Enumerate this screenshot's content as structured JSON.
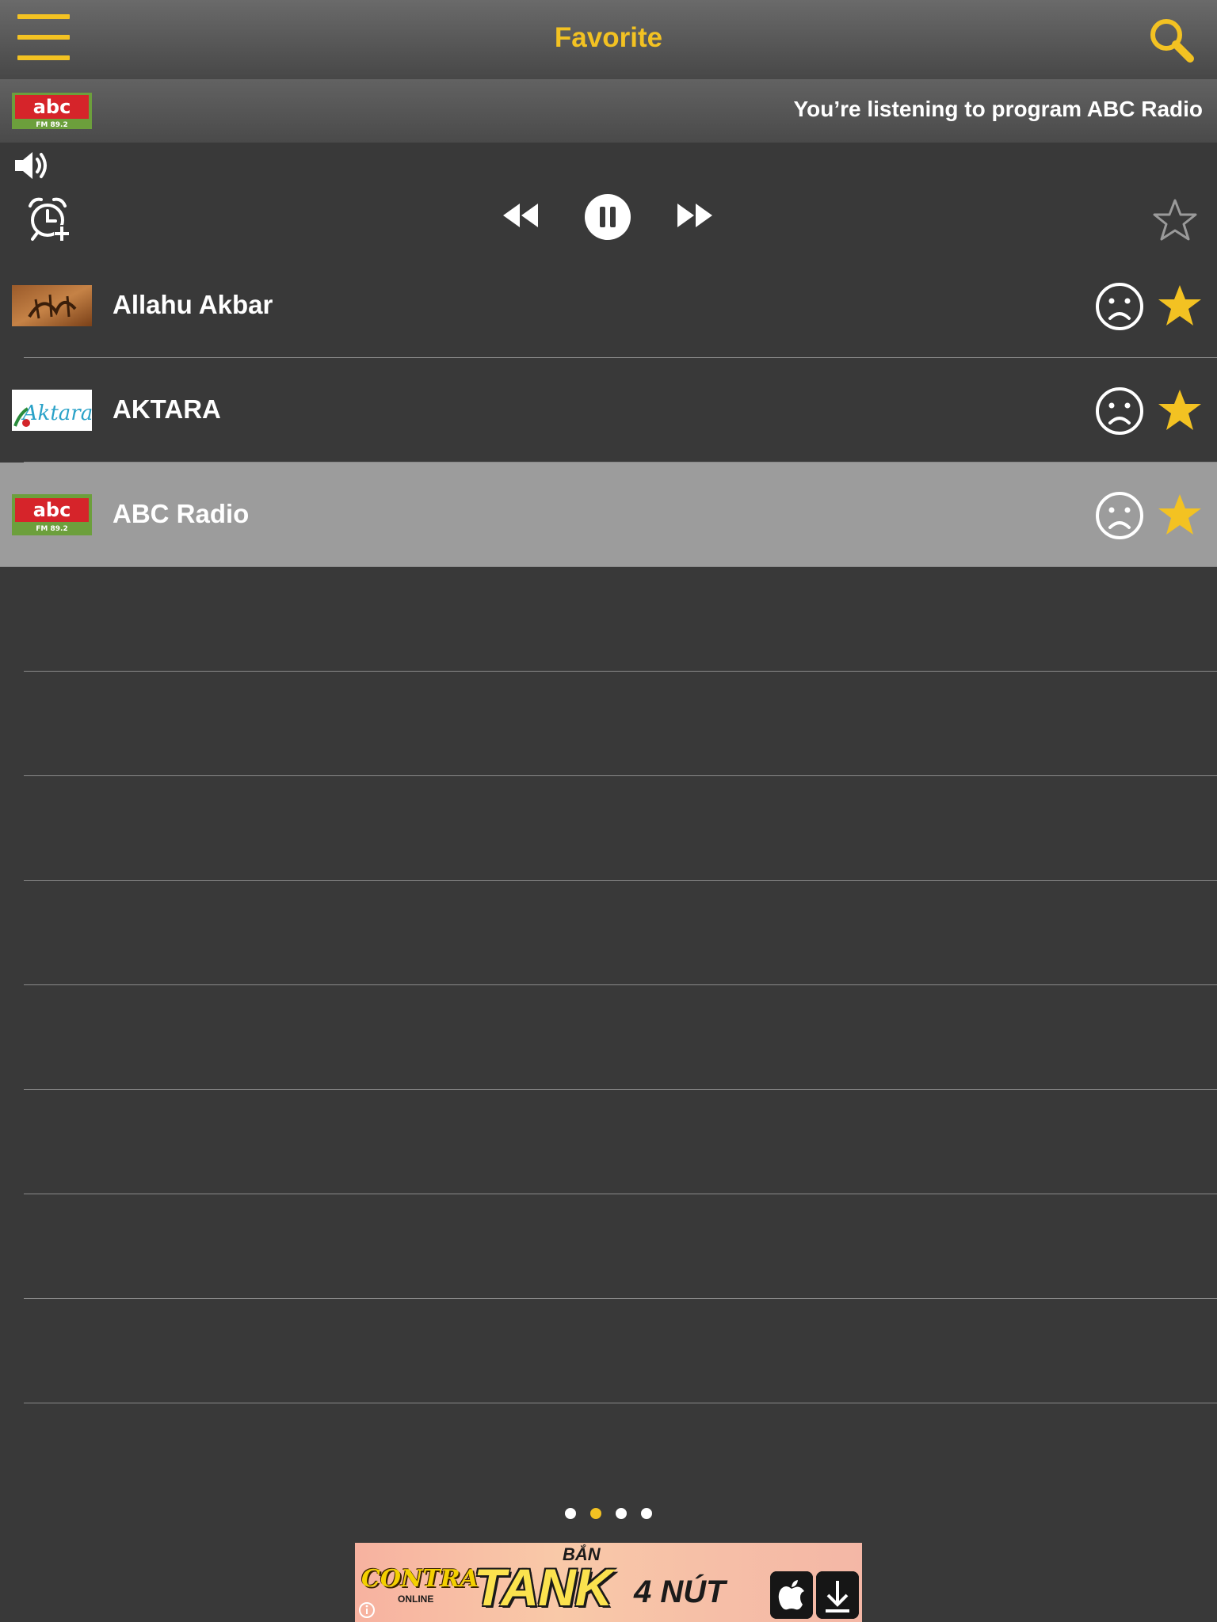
{
  "header": {
    "title": "Favorite",
    "menu_icon": "hamburger-menu-icon",
    "search_icon": "search-icon"
  },
  "now_playing": {
    "logo_text": "abc",
    "logo_sub": "FM 89.2",
    "text": "You’re listening to program ABC Radio"
  },
  "player": {
    "volume_icon": "volume-icon",
    "alarm_icon": "alarm-add-icon",
    "rewind_icon": "rewind-icon",
    "pause_icon": "pause-icon",
    "forward_icon": "fast-forward-icon",
    "favorite_icon": "star-outline-icon"
  },
  "stations": [
    {
      "name": "Allahu Akbar",
      "logo": "calligraphy-logo",
      "favorite": true,
      "selected": false
    },
    {
      "name": "AKTARA",
      "logo_text": "Aktara",
      "favorite": true,
      "selected": false
    },
    {
      "name": "ABC Radio",
      "logo_text": "abc",
      "logo_sub": "FM 89.2",
      "favorite": true,
      "selected": true
    }
  ],
  "pagination": {
    "count": 4,
    "active_index": 1
  },
  "ad": {
    "logo_text": "CONTRA",
    "logo_sub": "ONLINE",
    "ban_text": "BẮN",
    "tank_text": "TANK",
    "nut_text": "4 NÚT"
  },
  "colors": {
    "accent": "#f3c222",
    "background": "#393939",
    "selected_row": "#9c9c9c",
    "text": "#ffffff"
  }
}
